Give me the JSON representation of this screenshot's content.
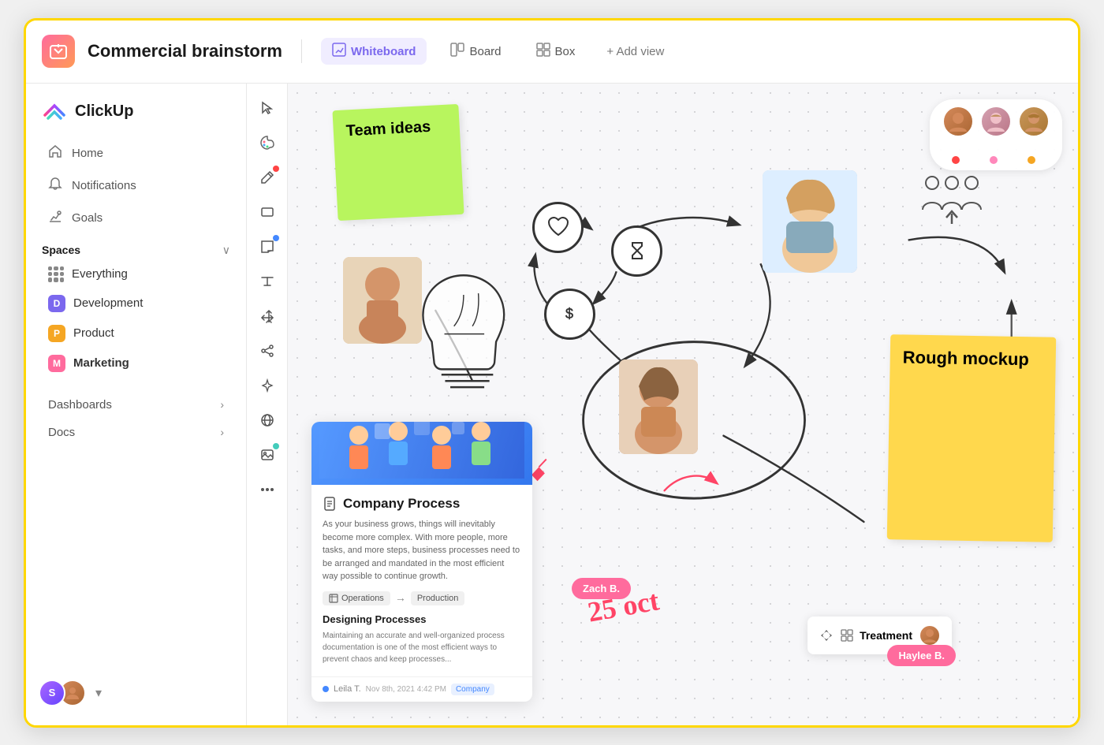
{
  "app": {
    "name": "ClickUp",
    "window_border_color": "#FFD700"
  },
  "header": {
    "workspace_icon": "📦",
    "doc_title": "Commercial brainstorm",
    "views": [
      {
        "id": "whiteboard",
        "label": "Whiteboard",
        "icon": "✏️",
        "active": true
      },
      {
        "id": "board",
        "label": "Board",
        "icon": "⬜"
      },
      {
        "id": "box",
        "label": "Box",
        "icon": "⊞"
      }
    ],
    "add_view_label": "+ Add view"
  },
  "sidebar": {
    "nav_items": [
      {
        "id": "home",
        "label": "Home",
        "icon": "🏠"
      },
      {
        "id": "notifications",
        "label": "Notifications",
        "icon": "🔔"
      },
      {
        "id": "goals",
        "label": "Goals",
        "icon": "🏆"
      }
    ],
    "spaces_label": "Spaces",
    "spaces": [
      {
        "id": "everything",
        "label": "Everything",
        "color": null
      },
      {
        "id": "development",
        "label": "Development",
        "color": "#7b68ee",
        "initial": "D"
      },
      {
        "id": "product",
        "label": "Product",
        "color": "#f5a623",
        "initial": "P"
      },
      {
        "id": "marketing",
        "label": "Marketing",
        "color": "#ff6b9d",
        "initial": "M",
        "active": true
      }
    ],
    "sections": [
      {
        "id": "dashboards",
        "label": "Dashboards"
      },
      {
        "id": "docs",
        "label": "Docs"
      }
    ]
  },
  "toolbar": {
    "tools": [
      {
        "id": "cursor",
        "icon": "↖",
        "dot": null
      },
      {
        "id": "palette",
        "icon": "🎨",
        "dot": null
      },
      {
        "id": "pen",
        "icon": "✏",
        "dot": "red"
      },
      {
        "id": "rectangle",
        "icon": "⬜",
        "dot": null
      },
      {
        "id": "note",
        "icon": "📝",
        "dot": "blue"
      },
      {
        "id": "text",
        "icon": "T",
        "dot": null
      },
      {
        "id": "move",
        "icon": "⤡",
        "dot": null
      },
      {
        "id": "share",
        "icon": "⎈",
        "dot": null
      },
      {
        "id": "sparkle",
        "icon": "✨",
        "dot": null
      },
      {
        "id": "globe",
        "icon": "🌐",
        "dot": null
      },
      {
        "id": "image",
        "icon": "🖼",
        "dot": "teal"
      },
      {
        "id": "more",
        "icon": "•••",
        "dot": null
      }
    ]
  },
  "whiteboard": {
    "sticky_notes": [
      {
        "id": "team-ideas",
        "text": "Team ideas",
        "color": "#b8f55e",
        "rotation": "-3deg"
      },
      {
        "id": "rough-mockup",
        "text": "Rough mockup",
        "color": "#ffd84d",
        "rotation": "1deg"
      }
    ],
    "circles": [
      {
        "id": "heart",
        "icon": "♡"
      },
      {
        "id": "hourglass",
        "icon": "⧗"
      },
      {
        "id": "dollar",
        "icon": "$"
      }
    ],
    "doc_card": {
      "title": "Company Process",
      "body_text": "As your business grows, things will inevitably become more complex. With more people, more tasks, and more steps, business processes need to be arranged and mandated in the most efficient way possible to continue growth.",
      "tags": [
        {
          "label": "Operations",
          "arrow": "→",
          "dest": "Production"
        }
      ],
      "subtitle": "Designing Processes",
      "subtext": "Maintaining an accurate and well-organized process documentation is one of the most efficient ways to prevent chaos and keep processes...",
      "footer_author": "Leila T.",
      "footer_date": "Nov 8th, 2021  4:42 PM",
      "footer_badge": "Company"
    },
    "name_badges": [
      {
        "id": "zach",
        "label": "Zach B.",
        "color": "#ff6b9d"
      },
      {
        "id": "haylee",
        "label": "Haylee B.",
        "color": "#ff6b9d"
      }
    ],
    "date_annotation": "25 oct",
    "task_card": {
      "label": "Treatment",
      "icon": "⊞"
    },
    "avatars": [
      {
        "id": "avatar1",
        "color": "#d4895a",
        "dot_color": "#ff4444"
      },
      {
        "id": "avatar2",
        "color": "#d4a0b0",
        "dot_color": "#ff88bb"
      },
      {
        "id": "avatar3",
        "color": "#c8965a",
        "dot_color": "#f5a623"
      }
    ]
  }
}
